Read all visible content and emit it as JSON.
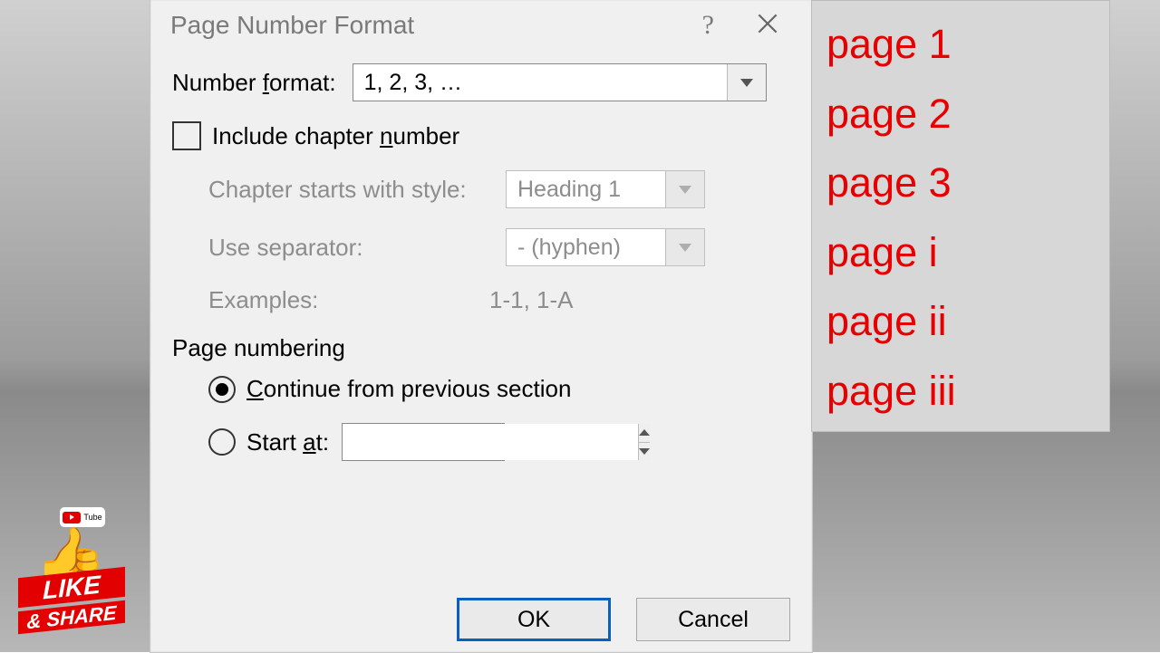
{
  "dialog": {
    "title": "Page Number Format",
    "format_label_pre": "Number ",
    "format_label_u": "f",
    "format_label_post": "ormat:",
    "format_value": "1, 2, 3, …",
    "include_chapter_pre": "Include chapter ",
    "include_chapter_u": "n",
    "include_chapter_post": "umber",
    "chapter_starts": "Chapter starts with style:",
    "chapter_starts_value": "Heading 1",
    "use_separator": "Use separator:",
    "use_separator_value": "-   (hyphen)",
    "examples_label": "Examples:",
    "examples_value": "1-1, 1-A",
    "page_numbering": "Page numbering",
    "continue_u": "C",
    "continue_label": "ontinue from previous section",
    "start_pre": "Start ",
    "start_u": "a",
    "start_post": "t:",
    "ok": "OK",
    "cancel": "Cancel"
  },
  "panel": [
    "page 1",
    "page 2",
    "page 3",
    "page i",
    "page ii",
    "page iii"
  ],
  "badge": {
    "youtube": "Tube",
    "like": "LIKE",
    "share": "& SHARE"
  }
}
